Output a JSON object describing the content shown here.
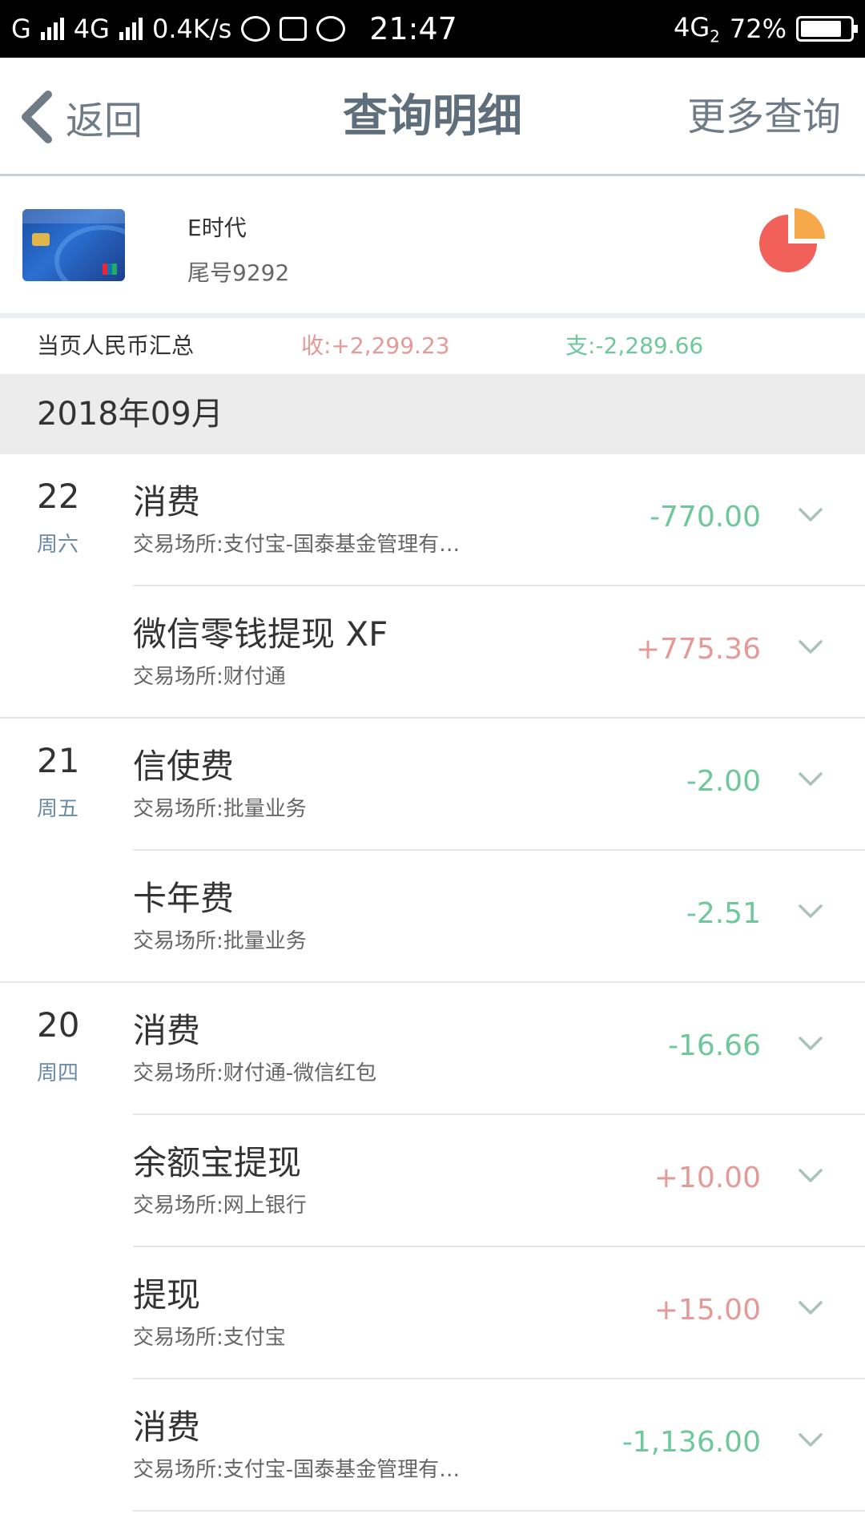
{
  "status_bar": {
    "network1": "G",
    "network2": "4G",
    "speed": "0.4K/s",
    "time": "21:47",
    "net_right": "4G",
    "net_right_sub": "2",
    "battery": "72%"
  },
  "nav": {
    "back_label": "返回",
    "title": "查询明细",
    "more_label": "更多查询"
  },
  "card": {
    "name": "E时代",
    "tail": "尾号9292"
  },
  "summary": {
    "label": "当页人民币汇总",
    "income": "收:+2,299.23",
    "expense": "支:-2,289.66"
  },
  "month": "2018年09月",
  "colors": {
    "income": "#e59a98",
    "expense": "#6fc79c",
    "pie_main": "#f2605a",
    "pie_slice": "#f6a94a"
  },
  "transactions": [
    {
      "day": "22",
      "weekday": "周六",
      "title": "消费",
      "place": "交易场所:支付宝-国泰基金管理有…",
      "amount": "-770.00",
      "sign": "neg"
    },
    {
      "day": "",
      "weekday": "",
      "title": "微信零钱提现 XF",
      "place": "交易场所:财付通",
      "amount": "+775.36",
      "sign": "pos"
    },
    {
      "day": "21",
      "weekday": "周五",
      "title": "信使费",
      "place": "交易场所:批量业务",
      "amount": "-2.00",
      "sign": "neg"
    },
    {
      "day": "",
      "weekday": "",
      "title": "卡年费",
      "place": "交易场所:批量业务",
      "amount": "-2.51",
      "sign": "neg"
    },
    {
      "day": "20",
      "weekday": "周四",
      "title": "消费",
      "place": "交易场所:财付通-微信红包",
      "amount": "-16.66",
      "sign": "neg"
    },
    {
      "day": "",
      "weekday": "",
      "title": "余额宝提现",
      "place": "交易场所:网上银行",
      "amount": "+10.00",
      "sign": "pos"
    },
    {
      "day": "",
      "weekday": "",
      "title": "提现",
      "place": "交易场所:支付宝",
      "amount": "+15.00",
      "sign": "pos"
    },
    {
      "day": "",
      "weekday": "",
      "title": "消费",
      "place": "交易场所:支付宝-国泰基金管理有…",
      "amount": "-1,136.00",
      "sign": "neg"
    }
  ]
}
